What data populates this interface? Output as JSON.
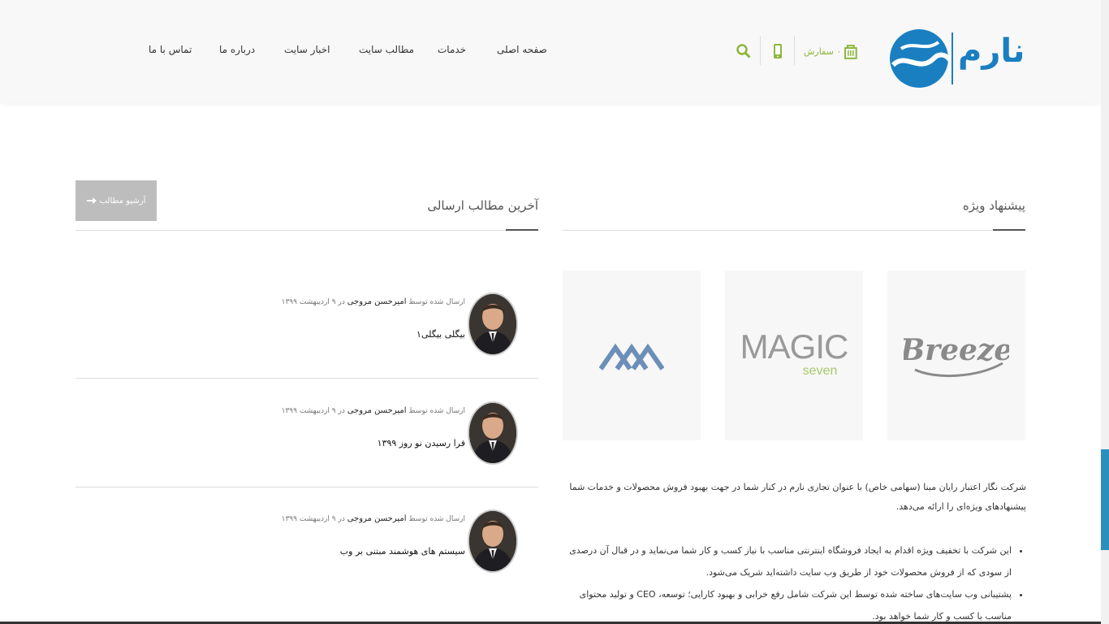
{
  "header": {
    "logo_text": "نارم",
    "cart_label": "۰ سفارش",
    "nav": [
      {
        "label": "صفحه اصلی"
      },
      {
        "label": "خدمات"
      },
      {
        "label": "مطالب سایت"
      },
      {
        "label": "اخبار سایت"
      },
      {
        "label": "درباره ما"
      },
      {
        "label": "تماس با ما"
      }
    ]
  },
  "special_offer": {
    "title": "پیشنهاد ویژه",
    "brands": [
      "Breeze",
      "MAGIC",
      "seven"
    ],
    "intro": "شرکت نگار اعتبار رایان مبنا (سهامی خاص) با عنوان تجاری نارم در کنار شما در جهت بهبود فروش محصولات و خدمات شما پیشنهادهای ویژه‌ای را ارائه می‌دهد.",
    "bullets": [
      "این شرکت با تخفیف ویژه اقدام به ایجاد فروشگاه اینترنتی مناسب با نیاز کسب و کار شما می‌نماید و در قبال آن درصدی از سودی که از فروش محصولات خود از طریق وب سایت داشته‌اید شریک می‌شود.",
      "پشتیبانی وب سایت‌های ساخته شده توسط این شرکت شامل رفع خرابی و بهبود کارایی؛ توسعه، CEO و تولید محتوای مناسب با کسب و کار شما خواهد بود."
    ]
  },
  "latest_posts": {
    "title": "آخرین مطالب ارسالی",
    "archive_label": "آرشیو مطالب",
    "posts": [
      {
        "sent_by": "ارسال شده توسط",
        "author": "امیرحسن مروجی",
        "in": "در",
        "date": "۹ اردیبهشت ۱۳۹۹",
        "title": "بیگلی بیگلی۱"
      },
      {
        "sent_by": "ارسال شده توسط",
        "author": "امیرحسن مروجی",
        "in": "در",
        "date": "۹ اردیبهشت ۱۳۹۹",
        "title": "فرا رسیدن نو روز ۱۳۹۹"
      },
      {
        "sent_by": "ارسال شده توسط",
        "author": "امیرحسن مروجی",
        "in": "در",
        "date": "۹ اردیبهشت ۱۳۹۹",
        "title": "سیستم های هوشمند مبتنی بر وب"
      }
    ]
  },
  "colors": {
    "brand_blue": "#1a7fc1",
    "accent_green": "#8cb63c",
    "archive_btn": "#bdbdbd"
  }
}
